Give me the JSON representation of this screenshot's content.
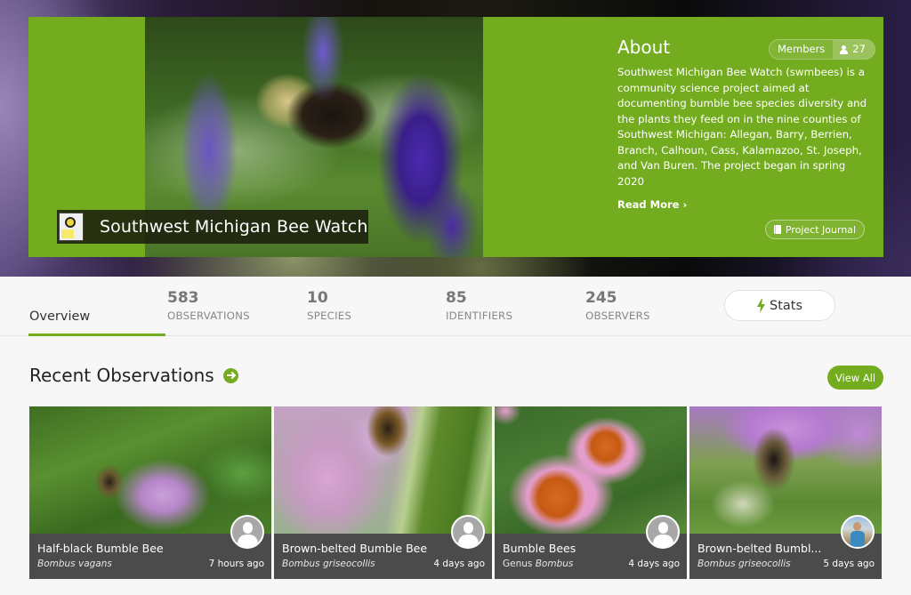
{
  "project": {
    "title": "Southwest Michigan Bee Watch"
  },
  "about": {
    "heading": "About",
    "members_label": "Members",
    "members_count": "27",
    "description": "Southwest Michigan Bee Watch (swmbees) is a community science project aimed at documenting bumble bee species diversity and the plants they feed on in the nine counties of Southwest Michigan: Allegan, Barry, Berrien, Branch, Calhoun, Cass, Kalamazoo, St. Joseph, and Van Buren. The project began in spring 2020",
    "read_more": "Read More ›",
    "journal_label": "Project Journal"
  },
  "stats": {
    "overview_tab": "Overview",
    "items": [
      {
        "value": "583",
        "label": "OBSERVATIONS"
      },
      {
        "value": "10",
        "label": "SPECIES"
      },
      {
        "value": "85",
        "label": "IDENTIFIERS"
      },
      {
        "value": "245",
        "label": "OBSERVERS"
      }
    ],
    "stats_button": "Stats"
  },
  "recent": {
    "heading": "Recent Observations",
    "view_all": "View All",
    "observations": [
      {
        "common_name": "Half-black Bumble Bee",
        "rank_prefix": "",
        "scientific_name": "Bombus vagans",
        "time": "7 hours ago",
        "avatar": "default-user-icon"
      },
      {
        "common_name": "Brown-belted Bumble Bee",
        "rank_prefix": "",
        "scientific_name": "Bombus griseocollis",
        "time": "4 days ago",
        "avatar": "default-user-icon"
      },
      {
        "common_name": "Bumble Bees",
        "rank_prefix": "Genus ",
        "scientific_name": "Bombus",
        "time": "4 days ago",
        "avatar": "default-user-icon"
      },
      {
        "common_name": "Brown-belted Bumbl...",
        "rank_prefix": "",
        "scientific_name": "Bombus griseocollis",
        "time": "5 days ago",
        "avatar": "user-photo"
      }
    ]
  },
  "colors": {
    "brand_green": "#74ac1f",
    "card_footer": "#4b4b4b",
    "page_bg": "#f7f7f7"
  }
}
